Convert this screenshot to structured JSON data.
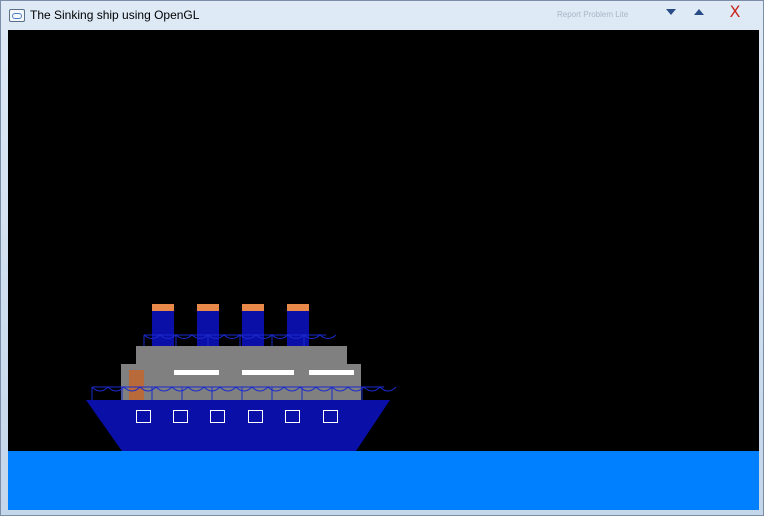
{
  "window": {
    "title": "The Sinking ship using OpenGL",
    "ghost_text": "Report Problem   Lite",
    "close_glyph": "X",
    "icons": {
      "app": "opengl-app-icon",
      "minimize": "minimize-icon",
      "maximize": "maximize-icon",
      "close": "close-icon"
    }
  },
  "scene": {
    "colors": {
      "sky": "#000000",
      "sea": "#0080ff",
      "hull": "#0a0fa8",
      "superstructure": "#808080",
      "funnel": "#0a0fa8",
      "funnel_cap": "#e8894a",
      "door": "#b86a3a",
      "window_strip": "#ffffff",
      "porthole": "#ffffff",
      "railing": "#1a2acc"
    },
    "funnel_count": 4,
    "porthole_count": 6,
    "window_strip_count": 3
  }
}
